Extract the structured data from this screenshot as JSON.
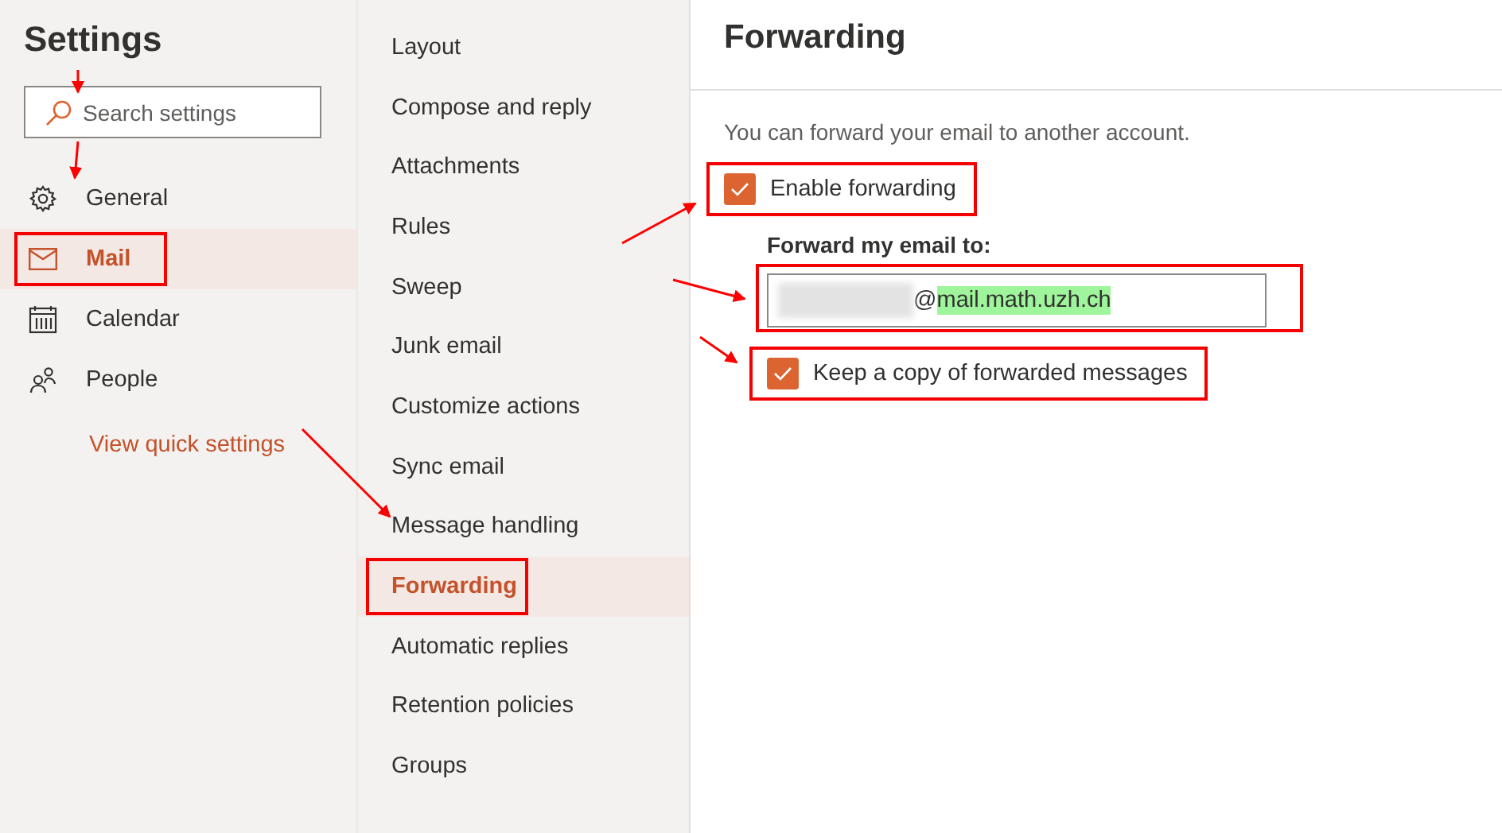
{
  "sidebar": {
    "title": "Settings",
    "search": {
      "placeholder": "Search settings"
    },
    "items": [
      {
        "label": "General",
        "selected": false,
        "annotated": false
      },
      {
        "label": "Mail",
        "selected": true,
        "annotated": true
      },
      {
        "label": "Calendar",
        "selected": false,
        "annotated": false
      },
      {
        "label": "People",
        "selected": false,
        "annotated": false
      }
    ],
    "link": "View quick settings"
  },
  "submenu": {
    "items": [
      {
        "label": "Layout",
        "selected": false,
        "annotated": false
      },
      {
        "label": "Compose and reply",
        "selected": false,
        "annotated": false
      },
      {
        "label": "Attachments",
        "selected": false,
        "annotated": false
      },
      {
        "label": "Rules",
        "selected": false,
        "annotated": false
      },
      {
        "label": "Sweep",
        "selected": false,
        "annotated": false
      },
      {
        "label": "Junk email",
        "selected": false,
        "annotated": false
      },
      {
        "label": "Customize actions",
        "selected": false,
        "annotated": false
      },
      {
        "label": "Sync email",
        "selected": false,
        "annotated": false
      },
      {
        "label": "Message handling",
        "selected": false,
        "annotated": false
      },
      {
        "label": "Forwarding",
        "selected": true,
        "annotated": true
      },
      {
        "label": "Automatic replies",
        "selected": false,
        "annotated": false
      },
      {
        "label": "Retention policies",
        "selected": false,
        "annotated": false
      },
      {
        "label": "Groups",
        "selected": false,
        "annotated": false
      }
    ]
  },
  "panel": {
    "title": "Forwarding",
    "description": "You can forward your email to another account.",
    "enable": {
      "label": "Enable forwarding",
      "checked": true,
      "annotated": true
    },
    "forward_to": {
      "label": "Forward my email to:",
      "redacted": true,
      "annotated": true,
      "value_parts": [
        {
          "text": "@",
          "highlighted": false
        },
        {
          "text": "mail.math.uzh.ch",
          "highlighted": true
        }
      ]
    },
    "keep_copy": {
      "label": "Keep a copy of forwarded messages",
      "checked": true,
      "annotated": true
    }
  }
}
